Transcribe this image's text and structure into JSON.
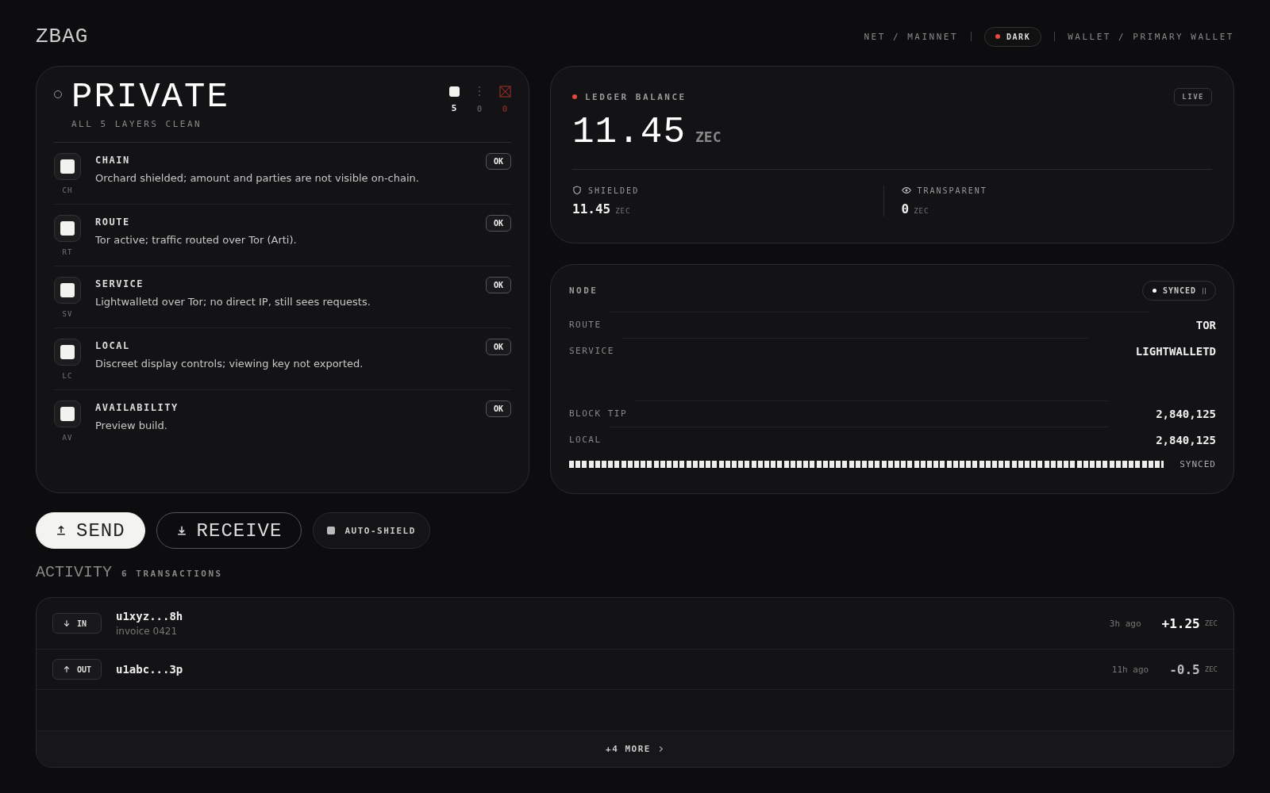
{
  "brand": "ZBAG",
  "header": {
    "network": "NET / MAINNET",
    "theme": {
      "label": "DARK",
      "color": "#e5483f"
    },
    "wallet": "WALLET / PRIMARY WALLET"
  },
  "privacy": {
    "status": "PRIVATE",
    "summary": "ALL 5 LAYERS CLEAN",
    "counts": [
      {
        "kind": "ok",
        "value": "5"
      },
      {
        "kind": "warn",
        "value": "0"
      },
      {
        "kind": "fail",
        "value": "0"
      }
    ],
    "layers": [
      {
        "name": "CHAIN",
        "code": "CH",
        "description": "Orchard shielded; amount and parties are not visible on-chain.",
        "checked": true,
        "badge": "OK"
      },
      {
        "name": "ROUTE",
        "code": "RT",
        "description": "Tor active; traffic routed over Tor (Arti).",
        "checked": true,
        "badge": "OK"
      },
      {
        "name": "SERVICE",
        "code": "SV",
        "description": "Lightwalletd over Tor; no direct IP, still sees requests.",
        "checked": true,
        "badge": "OK"
      },
      {
        "name": "LOCAL",
        "code": "LC",
        "description": "Discreet display controls; viewing key not exported.",
        "checked": true,
        "badge": "OK"
      },
      {
        "name": "AVAILABILITY",
        "code": "AV",
        "description": "Preview build.",
        "checked": true,
        "badge": "OK"
      }
    ]
  },
  "balance": {
    "title": "LEDGER BALANCE",
    "color": "#e5483f",
    "badge": "LIVE",
    "amount": "11.45",
    "unit": "ZEC",
    "parts": [
      {
        "kind": "shielded",
        "label": "SHIELDED",
        "amount": "11.45",
        "unit": "ZEC"
      },
      {
        "kind": "transparent",
        "label": "TRANSPARENT",
        "amount": "0",
        "unit": "ZEC"
      }
    ]
  },
  "node": {
    "title": "NODE",
    "status": "SYNCED",
    "connection": [
      {
        "label": "ROUTE",
        "value": "TOR"
      },
      {
        "label": "SERVICE",
        "value": "LIGHTWALLETD"
      }
    ],
    "heights": [
      {
        "label": "BLOCK TIP",
        "value": "2,840,125"
      },
      {
        "label": "LOCAL",
        "value": "2,840,125"
      }
    ],
    "sync": {
      "level": 1,
      "label": "SYNCED"
    }
  },
  "actions": [
    {
      "kind": "send",
      "label": "SEND"
    },
    {
      "kind": "receive",
      "label": "RECEIVE"
    }
  ],
  "auto_shield": {
    "label": "AUTO-SHIELD",
    "checked": false
  },
  "activity": {
    "title": "ACTIVITY",
    "count": "6 TRANSACTIONS",
    "transactions": [
      {
        "kind": "in",
        "label": "IN",
        "address": "u1xyz...8h",
        "memo": "invoice 0421",
        "time": "3h ago",
        "amount": "+1.25",
        "unit": "ZEC"
      },
      {
        "kind": "out",
        "label": "OUT",
        "address": "u1abc...3p",
        "time": "11h ago",
        "amount": "-0.5",
        "unit": "ZEC"
      }
    ],
    "more": "+4 MORE"
  }
}
